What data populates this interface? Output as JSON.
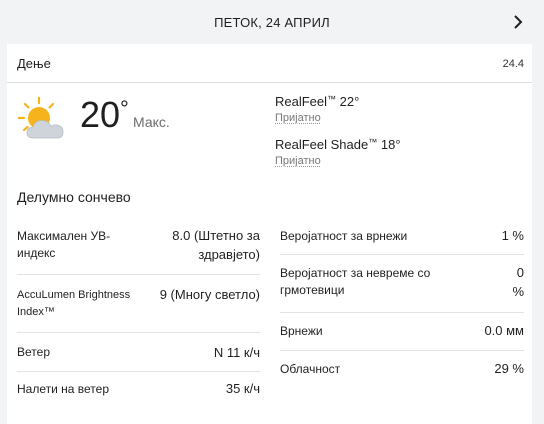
{
  "header": {
    "date": "ПЕТОК, 24 АПРИЛ",
    "next_icon": "chevron-right-icon"
  },
  "tab": {
    "label": "Дење",
    "date": "24.4"
  },
  "current": {
    "icon": "partly-sunny-icon",
    "temp_value": "20",
    "temp_unit": "°",
    "max_label": "Макс.",
    "realfeel_label": "RealFeel",
    "realfeel_value": "22°",
    "realfeel_phrase": "Пријатно",
    "realfeel_shade_label": "RealFeel Shade",
    "realfeel_shade_value": "18°",
    "realfeel_shade_phrase": "Пријатно",
    "trademark": "™",
    "phrase": "Делумно сончево"
  },
  "left_details": [
    {
      "label": "Максимален УВ-индекс",
      "value": "8.0 (Штетно за здравјето)"
    },
    {
      "label": "AccuLumen Brightness Index™",
      "value": "9 (Многу светло)"
    },
    {
      "label": "Ветер",
      "value": "N 11 к/ч"
    },
    {
      "label": "Налети на ветер",
      "value": "35 к/ч"
    }
  ],
  "right_details": [
    {
      "label": "Веројатност за врнежи",
      "value": "1 %"
    },
    {
      "label": "Веројатност за невреме со грмотевици",
      "value": "0 %"
    },
    {
      "label": "Врнежи",
      "value": "0.0 мм"
    },
    {
      "label": "Облачност",
      "value": "29 %"
    }
  ]
}
